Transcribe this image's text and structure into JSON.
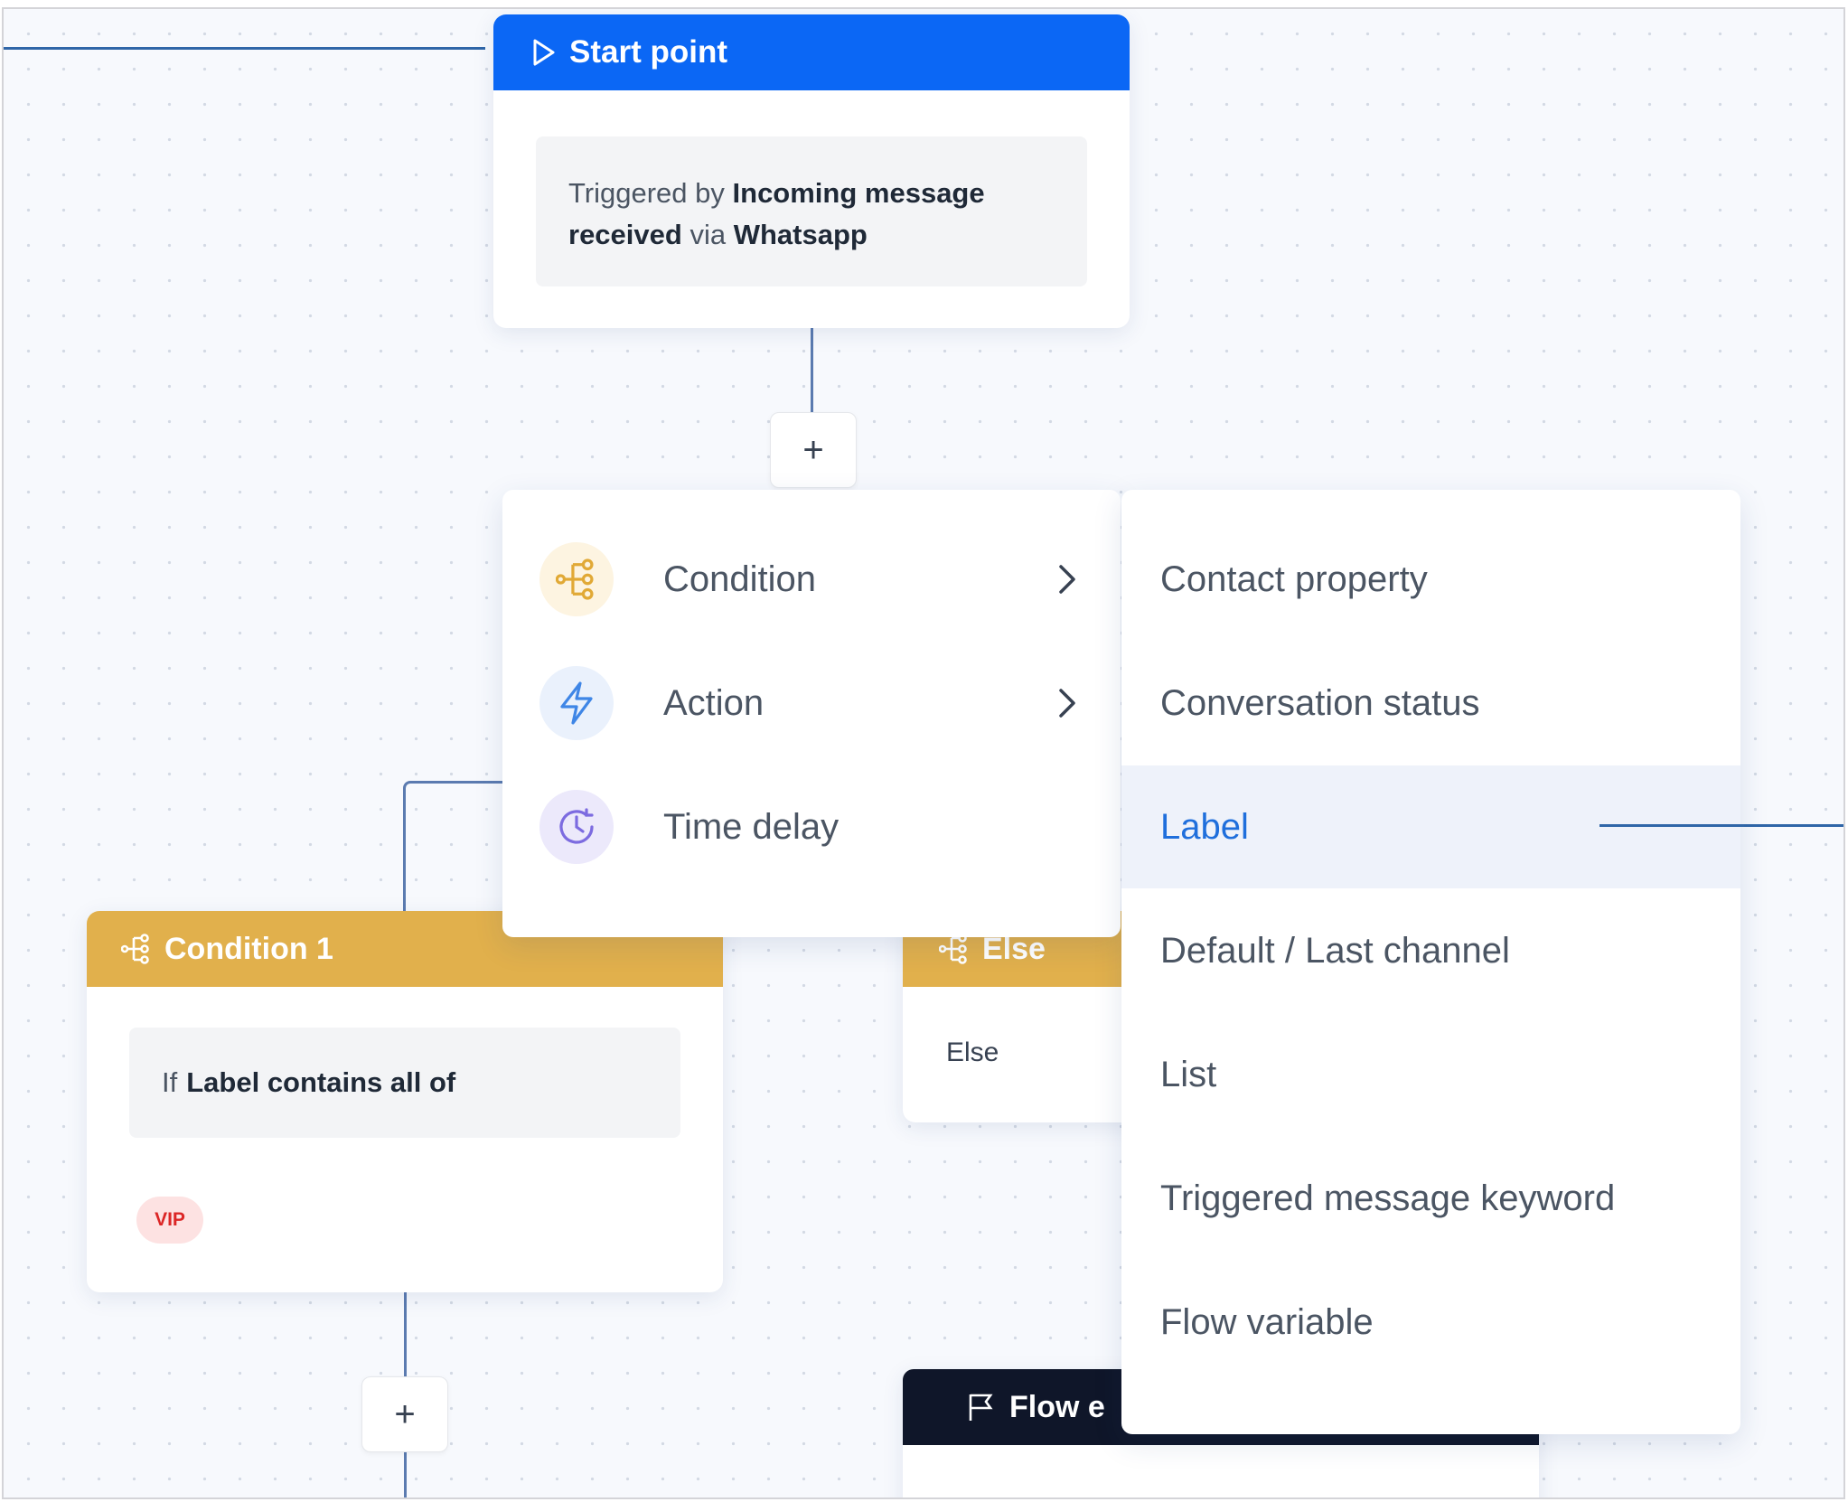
{
  "start_card": {
    "title": "Start point",
    "trigger_prefix": "Triggered by",
    "trigger_event": "Incoming message received",
    "trigger_via": "via",
    "trigger_channel": "Whatsapp"
  },
  "add_step_buttons": {
    "label": "+"
  },
  "step_menu": {
    "items": [
      {
        "label": "Condition",
        "icon": "condition-branch-icon",
        "has_submenu": true
      },
      {
        "label": "Action",
        "icon": "lightning-icon",
        "has_submenu": true
      },
      {
        "label": "Time delay",
        "icon": "clock-icon",
        "has_submenu": false
      }
    ]
  },
  "condition_submenu": {
    "items": [
      {
        "label": "Contact property"
      },
      {
        "label": "Conversation status"
      },
      {
        "label": "Label",
        "active": true
      },
      {
        "label": "Default / Last channel"
      },
      {
        "label": "List"
      },
      {
        "label": "Triggered message keyword"
      },
      {
        "label": "Flow variable"
      }
    ]
  },
  "condition_card": {
    "title": "Condition 1",
    "if_prefix": "If",
    "rule": "Label contains all of",
    "tag": "VIP"
  },
  "else_card": {
    "title": "Else",
    "body": "Else"
  },
  "flow_end_card": {
    "title": "Flow e"
  },
  "colors": {
    "start_header": "#0b67f5",
    "condition_header": "#e1b04c",
    "flow_end_header": "#0f1629",
    "active_item": "#1f6fdc",
    "tag_bg": "#fde2e2",
    "tag_text": "#dc2626"
  }
}
